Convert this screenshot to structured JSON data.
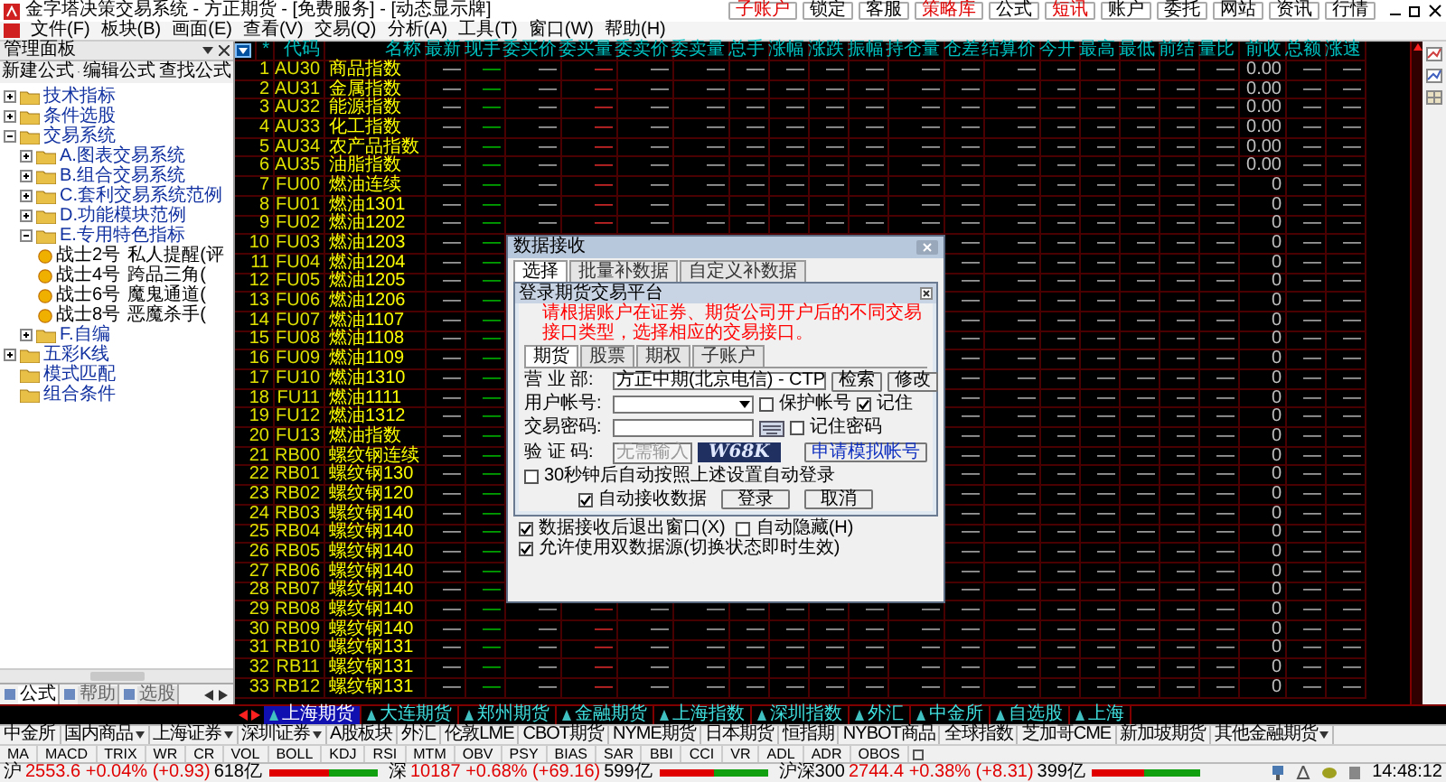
{
  "window": {
    "title": "金字塔决策交易系统 - 方正期货 - [免费服务] - [动态显示牌]"
  },
  "top_buttons": [
    {
      "label": "子账户",
      "highlighted": true
    },
    {
      "label": "锁定",
      "highlighted": false
    },
    {
      "label": "客服",
      "highlighted": false
    },
    {
      "label": "策略库",
      "highlighted": true
    },
    {
      "label": "公式",
      "highlighted": false
    },
    {
      "label": "短讯",
      "highlighted": true
    },
    {
      "label": "账户",
      "highlighted": false
    },
    {
      "label": "委托",
      "highlighted": false
    },
    {
      "label": "网站",
      "highlighted": false
    },
    {
      "label": "资讯",
      "highlighted": false
    },
    {
      "label": "行情",
      "highlighted": false
    }
  ],
  "menu": [
    "文件(F)",
    "板块(B)",
    "画面(E)",
    "查看(V)",
    "交易(Q)",
    "分析(A)",
    "工具(T)",
    "窗口(W)",
    "帮助(H)"
  ],
  "panel": {
    "title": "管理面板",
    "toolbar": [
      "新建公式",
      "编辑公式",
      "查找公式"
    ],
    "tree": [
      {
        "kind": "folder",
        "label": "技术指标",
        "expanded": false
      },
      {
        "kind": "folder",
        "label": "条件选股",
        "expanded": false
      },
      {
        "kind": "folder",
        "label": "交易系统",
        "expanded": true,
        "children": [
          {
            "kind": "folder",
            "label": "A.图表交易系统",
            "expanded": false
          },
          {
            "kind": "folder",
            "label": "B.组合交易系统",
            "expanded": false
          },
          {
            "kind": "folder",
            "label": "C.套利交易系统范例",
            "expanded": false
          },
          {
            "kind": "folder",
            "label": "D.功能模块范例",
            "expanded": false
          },
          {
            "kind": "folder",
            "label": "E.专用特色指标",
            "expanded": true,
            "children": [
              {
                "kind": "formula",
                "label": "战士2号",
                "note": "私人提醒(评"
              },
              {
                "kind": "formula",
                "label": "战士4号",
                "note": "跨品三角("
              },
              {
                "kind": "formula",
                "label": "战士6号",
                "note": "魔鬼通道("
              },
              {
                "kind": "formula",
                "label": "战士8号",
                "note": "恶魔杀手("
              }
            ]
          },
          {
            "kind": "folder",
            "label": "F.自编",
            "expanded": false
          }
        ]
      },
      {
        "kind": "folder",
        "label": "五彩K线",
        "expanded": false
      },
      {
        "kind": "plain",
        "label": "模式匹配"
      },
      {
        "kind": "plain",
        "label": "组合条件"
      }
    ],
    "tabs": [
      {
        "label": "公式",
        "selected": true
      },
      {
        "label": "帮助",
        "selected": false
      },
      {
        "label": "选股",
        "selected": false
      }
    ]
  },
  "table": {
    "columns": [
      "最新",
      "现手",
      "委买价",
      "委买量",
      "委卖价",
      "委卖量",
      "总手",
      "涨幅",
      "涨跌",
      "振幅",
      "持仓量",
      "仓差",
      "结算价",
      "今开",
      "最高",
      "最低",
      "前结",
      "量比",
      "前收",
      "总额",
      "涨速"
    ],
    "code_heading": "代码",
    "name_heading": "名称",
    "star_heading": "*",
    "rows": [
      {
        "no": "1",
        "code": "AU30",
        "name": "商品指数",
        "cells": [
          "—",
          "—",
          "—",
          "—",
          "—",
          "—",
          "—",
          "—",
          "—",
          "—",
          "—",
          "—",
          "—",
          "—",
          "—",
          "—",
          "—",
          "—",
          "0.00",
          "—",
          "—"
        ]
      },
      {
        "no": "2",
        "code": "AU31",
        "name": "金属指数",
        "cells": [
          "—",
          "—",
          "—",
          "—",
          "—",
          "—",
          "—",
          "—",
          "—",
          "—",
          "—",
          "—",
          "—",
          "—",
          "—",
          "—",
          "—",
          "—",
          "0.00",
          "—",
          "—"
        ]
      },
      {
        "no": "3",
        "code": "AU32",
        "name": "能源指数",
        "cells": [
          "—",
          "—",
          "—",
          "—",
          "—",
          "—",
          "—",
          "—",
          "—",
          "—",
          "—",
          "—",
          "—",
          "—",
          "—",
          "—",
          "—",
          "—",
          "0.00",
          "—",
          "—"
        ]
      },
      {
        "no": "4",
        "code": "AU33",
        "name": "化工指数",
        "cells": [
          "—",
          "—",
          "—",
          "—",
          "—",
          "—",
          "—",
          "—",
          "—",
          "—",
          "—",
          "—",
          "—",
          "—",
          "—",
          "—",
          "—",
          "—",
          "0.00",
          "—",
          "—"
        ]
      },
      {
        "no": "5",
        "code": "AU34",
        "name": "农产品指数",
        "cells": [
          "—",
          "—",
          "—",
          "—",
          "—",
          "—",
          "—",
          "—",
          "—",
          "—",
          "—",
          "—",
          "—",
          "—",
          "—",
          "—",
          "—",
          "—",
          "0.00",
          "—",
          "—"
        ]
      },
      {
        "no": "6",
        "code": "AU35",
        "name": "油脂指数",
        "cells": [
          "—",
          "—",
          "—",
          "—",
          "—",
          "—",
          "—",
          "—",
          "—",
          "—",
          "—",
          "—",
          "—",
          "—",
          "—",
          "—",
          "—",
          "—",
          "0.00",
          "—",
          "—"
        ]
      },
      {
        "no": "7",
        "code": "FU00",
        "name": "燃油连续",
        "cells": [
          "—",
          "—",
          "—",
          "—",
          "—",
          "—",
          "—",
          "—",
          "—",
          "—",
          "—",
          "—",
          "—",
          "—",
          "—",
          "—",
          "—",
          "—",
          "0",
          "—",
          "—"
        ]
      },
      {
        "no": "8",
        "code": "FU01",
        "name": "燃油1301",
        "cells": [
          "—",
          "—",
          "—",
          "—",
          "—",
          "—",
          "—",
          "—",
          "—",
          "—",
          "—",
          "—",
          "—",
          "—",
          "—",
          "—",
          "—",
          "—",
          "0",
          "—",
          "—"
        ]
      },
      {
        "no": "9",
        "code": "FU02",
        "name": "燃油1202",
        "cells": [
          "—",
          "—",
          "—",
          "—",
          "—",
          "—",
          "—",
          "—",
          "—",
          "—",
          "—",
          "—",
          "—",
          "—",
          "—",
          "—",
          "—",
          "—",
          "0",
          "—",
          "—"
        ]
      },
      {
        "no": "10",
        "code": "FU03",
        "name": "燃油1203",
        "cells": [
          "—",
          "—",
          null,
          null,
          null,
          null,
          null,
          null,
          null,
          null,
          null,
          "—",
          "—",
          "—",
          "—",
          "—",
          "—",
          "—",
          "0",
          "—",
          "—"
        ]
      },
      {
        "no": "11",
        "code": "FU04",
        "name": "燃油1204",
        "cells": [
          "—",
          "—",
          null,
          null,
          null,
          null,
          null,
          null,
          null,
          null,
          null,
          "—",
          "—",
          "—",
          "—",
          "—",
          "—",
          "—",
          "0",
          "—",
          "—"
        ]
      },
      {
        "no": "12",
        "code": "FU05",
        "name": "燃油1205",
        "cells": [
          "—",
          "—",
          null,
          null,
          null,
          null,
          null,
          null,
          null,
          null,
          null,
          "—",
          "—",
          "—",
          "—",
          "—",
          "—",
          "—",
          "0",
          "—",
          "—"
        ]
      },
      {
        "no": "13",
        "code": "FU06",
        "name": "燃油1206",
        "cells": [
          "—",
          "—",
          null,
          null,
          null,
          null,
          null,
          null,
          null,
          null,
          null,
          "—",
          "—",
          "—",
          "—",
          "—",
          "—",
          "—",
          "0",
          "—",
          "—"
        ]
      },
      {
        "no": "14",
        "code": "FU07",
        "name": "燃油1107",
        "cells": [
          "—",
          "—",
          null,
          null,
          null,
          null,
          null,
          null,
          null,
          null,
          null,
          "—",
          "—",
          "—",
          "—",
          "—",
          "—",
          "—",
          "0",
          "—",
          "—"
        ]
      },
      {
        "no": "15",
        "code": "FU08",
        "name": "燃油1108",
        "cells": [
          "—",
          "—",
          null,
          null,
          null,
          null,
          null,
          null,
          null,
          null,
          null,
          "—",
          "—",
          "—",
          "—",
          "—",
          "—",
          "—",
          "0",
          "—",
          "—"
        ]
      },
      {
        "no": "16",
        "code": "FU09",
        "name": "燃油1109",
        "cells": [
          "—",
          "—",
          null,
          null,
          null,
          null,
          null,
          null,
          null,
          null,
          null,
          "—",
          "—",
          "—",
          "—",
          "—",
          "—",
          "—",
          "0",
          "—",
          "—"
        ]
      },
      {
        "no": "17",
        "code": "FU10",
        "name": "燃油1310",
        "cells": [
          "—",
          "—",
          null,
          null,
          null,
          null,
          null,
          null,
          null,
          null,
          null,
          "—",
          "—",
          "—",
          "—",
          "—",
          "—",
          "—",
          "0",
          "—",
          "—"
        ]
      },
      {
        "no": "18",
        "code": "FU11",
        "name": "燃油1111",
        "cells": [
          "—",
          "—",
          null,
          null,
          null,
          null,
          null,
          null,
          null,
          null,
          null,
          "—",
          "—",
          "—",
          "—",
          "—",
          "—",
          "—",
          "0",
          "—",
          "—"
        ]
      },
      {
        "no": "19",
        "code": "FU12",
        "name": "燃油1312",
        "cells": [
          "—",
          "—",
          null,
          null,
          null,
          null,
          null,
          null,
          null,
          null,
          null,
          "—",
          "—",
          "—",
          "—",
          "—",
          "—",
          "—",
          "0",
          "—",
          "—"
        ]
      },
      {
        "no": "20",
        "code": "FU13",
        "name": "燃油指数",
        "cells": [
          "—",
          "—",
          null,
          null,
          null,
          null,
          null,
          null,
          null,
          null,
          null,
          "—",
          "—",
          "—",
          "—",
          "—",
          "—",
          "—",
          "0",
          "—",
          "—"
        ]
      },
      {
        "no": "21",
        "code": "RB00",
        "name": "螺纹钢连续",
        "cells": [
          "—",
          "—",
          null,
          null,
          null,
          null,
          null,
          null,
          null,
          null,
          null,
          "—",
          "—",
          "—",
          "—",
          "—",
          "—",
          "—",
          "0",
          "—",
          "—"
        ]
      },
      {
        "no": "22",
        "code": "RB01",
        "name": "螺纹钢130",
        "cells": [
          "—",
          "—",
          null,
          null,
          null,
          null,
          null,
          null,
          null,
          null,
          null,
          "—",
          "—",
          "—",
          "—",
          "—",
          "—",
          "—",
          "0",
          "—",
          "—"
        ]
      },
      {
        "no": "23",
        "code": "RB02",
        "name": "螺纹钢120",
        "cells": [
          "—",
          "—",
          null,
          null,
          null,
          null,
          null,
          null,
          null,
          null,
          null,
          "—",
          "—",
          "—",
          "—",
          "—",
          "—",
          "—",
          "0",
          "—",
          "—"
        ]
      },
      {
        "no": "24",
        "code": "RB03",
        "name": "螺纹钢140",
        "cells": [
          "—",
          "—",
          null,
          null,
          null,
          null,
          null,
          null,
          null,
          null,
          null,
          "—",
          "—",
          "—",
          "—",
          "—",
          "—",
          "—",
          "0",
          "—",
          "—"
        ]
      },
      {
        "no": "25",
        "code": "RB04",
        "name": "螺纹钢140",
        "cells": [
          "—",
          "—",
          null,
          null,
          null,
          null,
          null,
          null,
          null,
          null,
          null,
          "—",
          "—",
          "—",
          "—",
          "—",
          "—",
          "—",
          "0",
          "—",
          "—"
        ]
      },
      {
        "no": "26",
        "code": "RB05",
        "name": "螺纹钢140",
        "cells": [
          "—",
          "—",
          null,
          null,
          null,
          null,
          null,
          null,
          null,
          null,
          null,
          "—",
          "—",
          "—",
          "—",
          "—",
          "—",
          "—",
          "0",
          "—",
          "—"
        ]
      },
      {
        "no": "27",
        "code": "RB06",
        "name": "螺纹钢140",
        "cells": [
          "—",
          "—",
          null,
          null,
          null,
          null,
          null,
          null,
          null,
          null,
          null,
          "—",
          "—",
          "—",
          "—",
          "—",
          "—",
          "—",
          "0",
          "—",
          "—"
        ]
      },
      {
        "no": "28",
        "code": "RB07",
        "name": "螺纹钢140",
        "cells": [
          "—",
          "—",
          null,
          null,
          null,
          null,
          null,
          null,
          null,
          null,
          null,
          "—",
          "—",
          "—",
          "—",
          "—",
          "—",
          "—",
          "0",
          "—",
          "—"
        ]
      },
      {
        "no": "29",
        "code": "RB08",
        "name": "螺纹钢140",
        "cells": [
          "—",
          "—",
          "—",
          "—",
          "—",
          "—",
          "—",
          "—",
          "—",
          "—",
          "—",
          "—",
          "—",
          "—",
          "—",
          "—",
          "—",
          "—",
          "0",
          "—",
          "—"
        ]
      },
      {
        "no": "30",
        "code": "RB09",
        "name": "螺纹钢140",
        "cells": [
          "—",
          "—",
          "—",
          "—",
          "—",
          "—",
          "—",
          "—",
          "—",
          "—",
          "—",
          "—",
          "—",
          "—",
          "—",
          "—",
          "—",
          "—",
          "0",
          "—",
          "—"
        ]
      },
      {
        "no": "31",
        "code": "RB10",
        "name": "螺纹钢131",
        "cells": [
          "—",
          "—",
          "—",
          "—",
          "—",
          "—",
          "—",
          "—",
          "—",
          "—",
          "—",
          "—",
          "—",
          "—",
          "—",
          "—",
          "—",
          "—",
          "0",
          "—",
          "—"
        ]
      },
      {
        "no": "32",
        "code": "RB11",
        "name": "螺纹钢131",
        "cells": [
          "—",
          "—",
          "—",
          "—",
          "—",
          "—",
          "—",
          "—",
          "—",
          "—",
          "—",
          "—",
          "—",
          "—",
          "—",
          "—",
          "—",
          "—",
          "0",
          "—",
          "—"
        ]
      },
      {
        "no": "33",
        "code": "RB12",
        "name": "螺纹钢131",
        "cells": [
          "—",
          "—",
          "—",
          "—",
          "—",
          "—",
          "—",
          "—",
          "—",
          "—",
          "—",
          "—",
          "—",
          "—",
          "—",
          "—",
          "—",
          "—",
          "0",
          "—",
          "—"
        ]
      }
    ]
  },
  "dialog": {
    "title": "数据接收",
    "tabs": [
      {
        "label": "选择",
        "selected": true
      },
      {
        "label": "批量补数据",
        "selected": false
      },
      {
        "label": "自定义补数据",
        "selected": false
      }
    ],
    "login": {
      "title": "登录期货交易平台",
      "notice": "请根据账户在证券、期货公司开户后的不同交易接口类型，选择相应的交易接口。",
      "tabs": [
        {
          "label": "期货",
          "selected": true
        },
        {
          "label": "股票",
          "selected": false
        },
        {
          "label": "期权",
          "selected": false
        },
        {
          "label": "子账户",
          "selected": false
        }
      ],
      "branch_label": "营 业 部:",
      "branch_value": "方正中期(北京电信) - CTP",
      "search_button": "检索",
      "edit_button": "修改",
      "account_label": "用户帐号:",
      "protect": {
        "label": "保护帐号",
        "checked": false
      },
      "remember": {
        "label": "记住",
        "checked": true
      },
      "password_label": "交易密码:",
      "remember_password": {
        "label": "记住密码",
        "checked": false
      },
      "captcha_label": "验 证 码:",
      "captcha_placeholder": "无需输入",
      "captcha_text": "W68K",
      "apply_button": "申请模拟帐号",
      "auto_login": {
        "label": "30秒钟后自动按照上述设置自动登录",
        "checked": false
      },
      "auto_receive": {
        "label": "自动接收数据",
        "checked": true
      },
      "login_button": "登录",
      "cancel_button": "取消"
    },
    "options": [
      {
        "label": "数据接收后退出窗口(X)",
        "checked": true
      },
      {
        "label": "自动隐藏(H)",
        "checked": false
      },
      {
        "label": "允许使用双数据源(切换状态即时生效)",
        "checked": true
      }
    ]
  },
  "sheet_tabs": [
    {
      "label": "上海期货",
      "selected": true
    },
    {
      "label": "大连期货",
      "selected": false
    },
    {
      "label": "郑州期货",
      "selected": false
    },
    {
      "label": "金融期货",
      "selected": false
    },
    {
      "label": "上海指数",
      "selected": false
    },
    {
      "label": "深圳指数",
      "selected": false
    },
    {
      "label": "外汇",
      "selected": false
    },
    {
      "label": "中金所",
      "selected": false
    },
    {
      "label": "自选股",
      "selected": false
    },
    {
      "label": "上海",
      "selected": false
    }
  ],
  "markets": [
    {
      "label": "中金所",
      "dropdown": false
    },
    {
      "label": "国内商品",
      "dropdown": true
    },
    {
      "label": "上海证券",
      "dropdown": true
    },
    {
      "label": "深圳证券",
      "dropdown": true
    },
    {
      "label": "A股板块",
      "dropdown": false
    },
    {
      "label": "外汇",
      "dropdown": false
    },
    {
      "label": "伦敦LME",
      "dropdown": false
    },
    {
      "label": "CBOT期货",
      "dropdown": false
    },
    {
      "label": "NYME期货",
      "dropdown": false
    },
    {
      "label": "日本期货",
      "dropdown": false
    },
    {
      "label": "恒指期",
      "dropdown": false
    },
    {
      "label": "NYBOT商品",
      "dropdown": false
    },
    {
      "label": "全球指数",
      "dropdown": false
    },
    {
      "label": "芝加哥CME",
      "dropdown": false
    },
    {
      "label": "新加坡期货",
      "dropdown": false
    },
    {
      "label": "其他金融期货",
      "dropdown": true
    }
  ],
  "indicators": [
    "MA",
    "MACD",
    "TRIX",
    "WR",
    "CR",
    "VOL",
    "BOLL",
    "KDJ",
    "RSI",
    "MTM",
    "OBV",
    "PSY",
    "BIAS",
    "SAR",
    "BBI",
    "CCI",
    "VR",
    "ADL",
    "ADR",
    "OBOS"
  ],
  "status_bar": {
    "indexes": [
      {
        "market": "沪",
        "quote": "2553.6 +0.04% (+0.93)",
        "amount": "618亿",
        "level": 0.55
      },
      {
        "market": "深",
        "quote": "10187 +0.68% (+69.16)",
        "amount": "599亿",
        "level": 0.5
      },
      {
        "market": "沪深300",
        "quote": "2744.4 +0.38% (+8.31)",
        "amount": "399亿",
        "level": 0.48
      }
    ],
    "time": "14:48:12"
  }
}
